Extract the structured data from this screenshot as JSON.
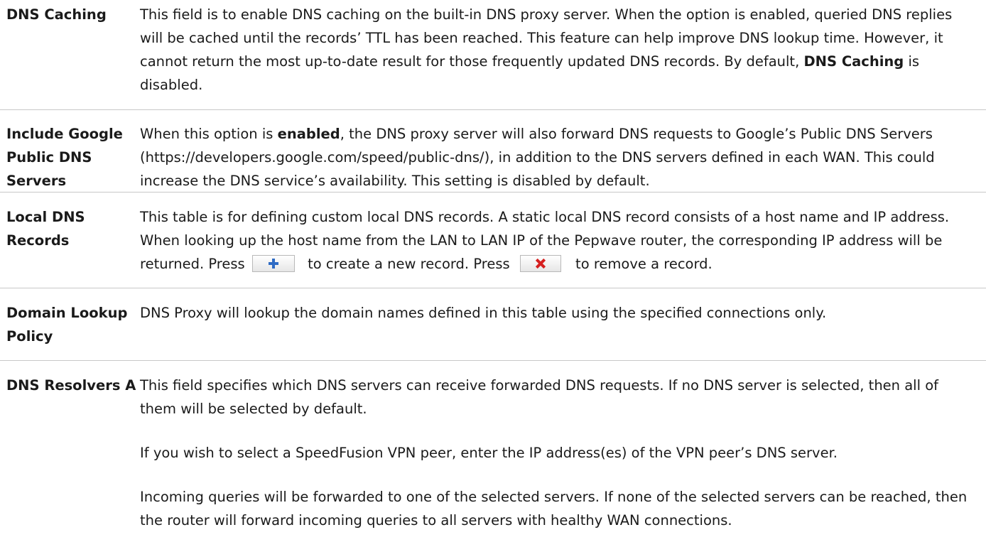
{
  "rows": [
    {
      "label": "DNS Caching",
      "desc": {
        "text1": "This field is to enable DNS caching on the built-in DNS proxy server. When the option is enabled, queried DNS replies will be cached until the records’ TTL has been reached. This feature can help improve DNS lookup time. However, it cannot return the most up-to-date result for those frequently updated DNS records. By default, ",
        "bold1": "DNS Caching",
        "text2": " is disabled."
      }
    },
    {
      "label": "Include Google Public DNS Servers",
      "desc": {
        "text1": "When this option is ",
        "bold1": "enabled",
        "text2": ", the DNS proxy server will also forward DNS requests to Google’s Public DNS Servers (https://developers.google.com/speed/public-dns/), in addition to the DNS servers defined in each WAN. This could increase the DNS service’s availability. This setting is disabled by default."
      }
    },
    {
      "label": "Local DNS Records",
      "desc": {
        "text1": "This table is for defining custom local DNS records. A static local DNS record consists of a host name and IP address. When looking up the host name from the LAN to LAN IP of the Pepwave router, the corresponding IP address will be returned. Press ",
        "text2": " to create a new record. Press ",
        "text3": " to remove a record.",
        "add_icon": "plus-icon",
        "remove_icon": "x-icon"
      }
    },
    {
      "label": "Domain Lookup Policy",
      "desc": {
        "text1": "DNS Proxy will lookup the domain names defined in this table using the specified connections only."
      }
    },
    {
      "label": "DNS Resolvers A",
      "desc": {
        "para1": "This field specifies which DNS servers can receive forwarded DNS requests. If no DNS server is selected, then all of them will be selected by default.",
        "para2": "If you wish to select a SpeedFusion VPN peer, enter the IP address(es) of the VPN peer’s DNS server.",
        "para3": "Incoming queries will be forwarded to one of the selected servers. If none of the selected servers can be reached, then the router will forward incoming queries to all servers with healthy WAN connections."
      }
    }
  ],
  "colors": {
    "divider": "#c8c8c8",
    "text": "#1a1a1a",
    "add_icon": "#2f6bc4",
    "remove_icon": "#d62020"
  }
}
